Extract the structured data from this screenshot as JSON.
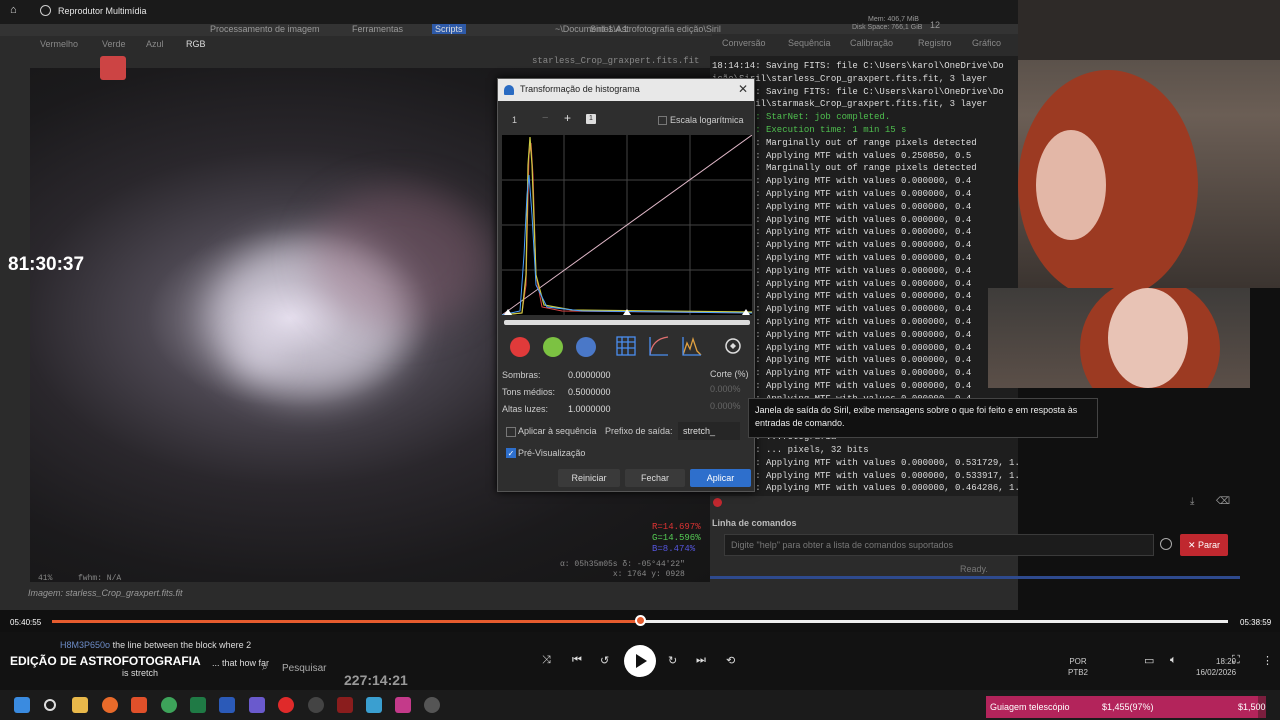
{
  "player": {
    "title": "Reprodutor Multimídia",
    "time_elapsed": "05:40:55",
    "time_remaining": "05:38:59",
    "progress": 0.5,
    "overlay_timer": "81:30:37",
    "stream_title": "EDIÇÃO DE ASTROFOTOGRAFIA",
    "timecode": "227:14:21"
  },
  "siril": {
    "header": {
      "menu_items": [
        "Processamento de imagem",
        "Ferramentas",
        "Scripts"
      ],
      "path": "~\\Documentos\\Astrofotografia edição\\Siril",
      "disk_space": "Disk Space: 766,1 GiB",
      "app_name": "Siril-1.4.1",
      "memory": "Mem: 406,7 MiB",
      "count": "12"
    },
    "image_tabs": [
      "Vermelho",
      "Verde",
      "Azul",
      "RGB"
    ],
    "filename_overlay": "starless_Crop_graxpert.fits.fit",
    "image_status": {
      "zoom": "41%",
      "fwhm": "fwhm: N/A"
    },
    "imagem_label": "Imagem: starless_Crop_graxpert.fits.fit",
    "rgb_readout": {
      "r": "R=14.697%",
      "g": "G=14.596%",
      "b": "B=8.474%"
    },
    "coords": {
      "radec": "α: 05h35m05s  δ: -05°44'22\"",
      "xy": "x: 1764  y: 0928"
    },
    "right_tabs": [
      "Conversão",
      "Sequência",
      "Calibração",
      "Registro",
      "Gráfico"
    ],
    "console_lines": [
      "18:14:14: Saving FITS: file C:\\Users\\karol\\OneDrive\\Do",
      "ição\\Siril\\starless_Crop_graxpert.fits.fit, 3 layer",
      "18:14:15: Saving FITS: file C:\\Users\\karol\\OneDrive\\Do",
      "ição\\Siril\\starmask_Crop_graxpert.fits.fit, 3 layer",
      "18:14:15: StarNet: job completed.",
      "18:14:15: Execution time: 1 min 15 s",
      "18:14:15: Marginally out of range pixels detected",
      "18:14:15: Applying MTF with values 0.250850, 0.5",
      "18:14:15: Marginally out of range pixels detected",
      "18:14:15: Applying MTF with values 0.000000, 0.4",
      "18:14:15: Applying MTF with values 0.000000, 0.4",
      "18:14:15: Applying MTF with values 0.000000, 0.4",
      "18:14:15: Applying MTF with values 0.000000, 0.4",
      "18:14:15: Applying MTF with values 0.000000, 0.4",
      "18:14:15: Applying MTF with values 0.000000, 0.4",
      "18:14:15: Applying MTF with values 0.000000, 0.4",
      "18:14:15: Applying MTF with values 0.000000, 0.4",
      "18:14:15: Applying MTF with values 0.000000, 0.4",
      "18:14:15: Applying MTF with values 0.000000, 0.4",
      "18:14:15: Applying MTF with values 0.000000, 0.4",
      "18:14:15: Applying MTF with values 0.000000, 0.4",
      "18:14:15: Applying MTF with values 0.000000, 0.4",
      "18:14:15: Applying MTF with values 0.000000, 0.4",
      "18:14:15: Applying MTF with values 0.000000, 0.4",
      "18:14:15: Applying MTF with values 0.000000, 0.4",
      "18:14:15: Applying MTF with values 0.000000, 0.4",
      "18:14:15: Applying MTF with values 0.000000, 0.4",
      "18:14:15: Applying MTF with values 0.000000, 0.4",
      "18:14:15: Applying MTF with values 0.000000, 0.469388, 1.000000",
      "18:14:15: ...fotografia",
      "18:14:15: ... pixels, 32 bits",
      "18:14:15: Applying MTF with values 0.000000, 0.531729, 1.000000",
      "18:14:15: Applying MTF with values 0.000000, 0.533917, 1.000000",
      "18:14:15: Applying MTF with values 0.000000, 0.464286, 1.000000"
    ],
    "command_line": {
      "label": "Linha de comandos",
      "placeholder": "Digite \"help\" para obter a lista de comandos suportados",
      "stop_label": "Parar",
      "status": "Ready."
    },
    "tooltip": "Janela de saída do Siril, exibe mensagens sobre o que foi feito e em resposta às entradas de comando."
  },
  "histogram_dialog": {
    "title": "Transformação de histograma",
    "zoom_value": "1",
    "log_scale_label": "Escala logarítmica",
    "fields": {
      "shadows_label": "Sombras:",
      "shadows_value": "0.0000000",
      "midtones_label": "Tons médios:",
      "midtones_value": "0.5000000",
      "highlights_label": "Altas luzes:",
      "highlights_value": "1.0000000",
      "clip_label": "Corte (%)",
      "clip_low": "0.000%",
      "clip_high": "0.000%"
    },
    "apply_sequence_label": "Aplicar à sequência",
    "prefix_label": "Prefixo de saída:",
    "prefix_value": "stretch_",
    "preview_label": "Pré-Visualização",
    "buttons": {
      "reset": "Reiniciar",
      "close": "Fechar",
      "apply": "Aplicar"
    },
    "colors": {
      "red": "#e03a3a",
      "green": "#7cc242",
      "blue": "#4a78c8"
    }
  },
  "chat": {
    "line1_user": "H8M3P650o",
    "line1_text": "the line between the block where 2",
    "line2_text": "... that how far",
    "line3_text": "is stretch"
  },
  "taskbar": {
    "search_placeholder": "Pesquisar",
    "lang": "POR",
    "layout": "PTB2",
    "time": "18:29",
    "date": "16/02/2026"
  },
  "goal": {
    "label": "Guiagem telescópio",
    "value": "$1,455(97%)",
    "target": "$1,500",
    "fraction": 0.97
  }
}
